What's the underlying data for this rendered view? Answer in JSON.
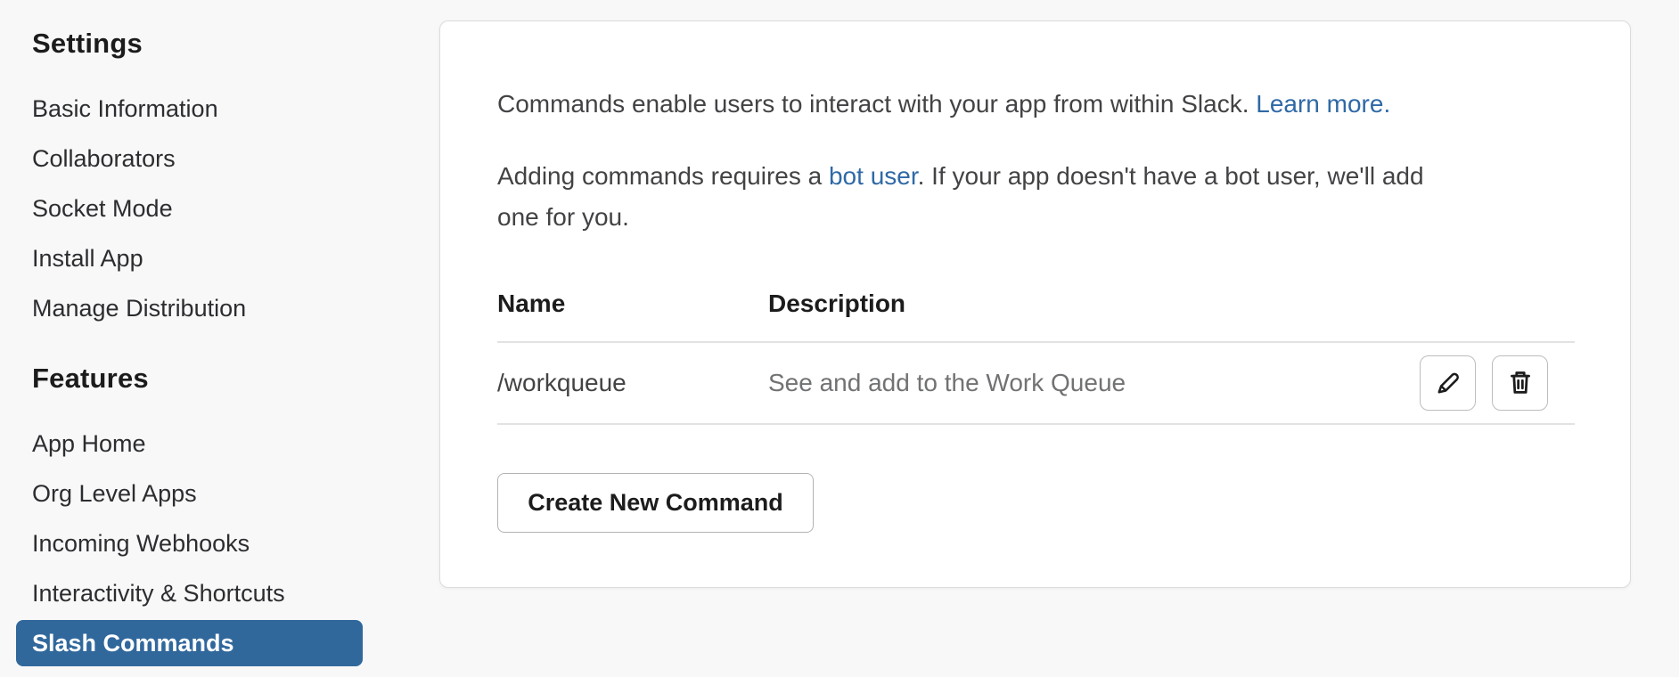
{
  "sidebar": {
    "sections": [
      {
        "heading": "Settings",
        "items": [
          "Basic Information",
          "Collaborators",
          "Socket Mode",
          "Install App",
          "Manage Distribution"
        ]
      },
      {
        "heading": "Features",
        "items": [
          "App Home",
          "Org Level Apps",
          "Incoming Webhooks",
          "Interactivity & Shortcuts",
          "Slash Commands"
        ]
      }
    ],
    "active_item": "Slash Commands"
  },
  "main": {
    "intro": {
      "text": "Commands enable users to interact with your app from within Slack. ",
      "link": "Learn more."
    },
    "note": {
      "before": "Adding commands requires a ",
      "link": "bot user",
      "after": ". If your app doesn't have a bot user, we'll add\none for you."
    },
    "table": {
      "columns": [
        "Name",
        "Description"
      ],
      "rows": [
        {
          "name": "/workqueue",
          "description": "See and add to the Work Queue"
        }
      ]
    },
    "actions": {
      "edit_icon": "pencil-icon",
      "delete_icon": "trash-icon"
    },
    "create_button_label": "Create New Command"
  },
  "colors": {
    "page_background": "#f8f8f8",
    "card_background": "#ffffff",
    "active_nav_background": "#31689c",
    "link_blue": "#2f69a6",
    "muted_text": "#717274",
    "table_border": "#e2e2e2"
  }
}
